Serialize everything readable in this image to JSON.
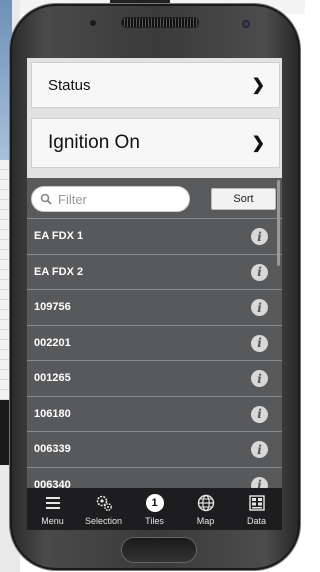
{
  "header": {
    "status_label": "Status",
    "ignition_label": "Ignition On"
  },
  "search": {
    "placeholder": "Filter",
    "sort_label": "Sort"
  },
  "list": {
    "items": [
      {
        "label": "EA FDX 1"
      },
      {
        "label": "EA FDX 2"
      },
      {
        "label": "109756"
      },
      {
        "label": "002201"
      },
      {
        "label": "001265"
      },
      {
        "label": "106180"
      },
      {
        "label": "006339"
      },
      {
        "label": "006340"
      }
    ]
  },
  "tabbar": {
    "tabs": [
      {
        "label": "Menu",
        "icon": "menu-icon"
      },
      {
        "label": "Selection",
        "icon": "gears-icon"
      },
      {
        "label": "Tiles",
        "icon": "count-badge",
        "badge": "1"
      },
      {
        "label": "Map",
        "icon": "globe-icon"
      },
      {
        "label": "Data",
        "icon": "data-icon"
      }
    ]
  },
  "colors": {
    "screen_bg": "#575759",
    "tabbar_bg": "#1d1d1f",
    "card_bg": "#f7f7f7"
  }
}
